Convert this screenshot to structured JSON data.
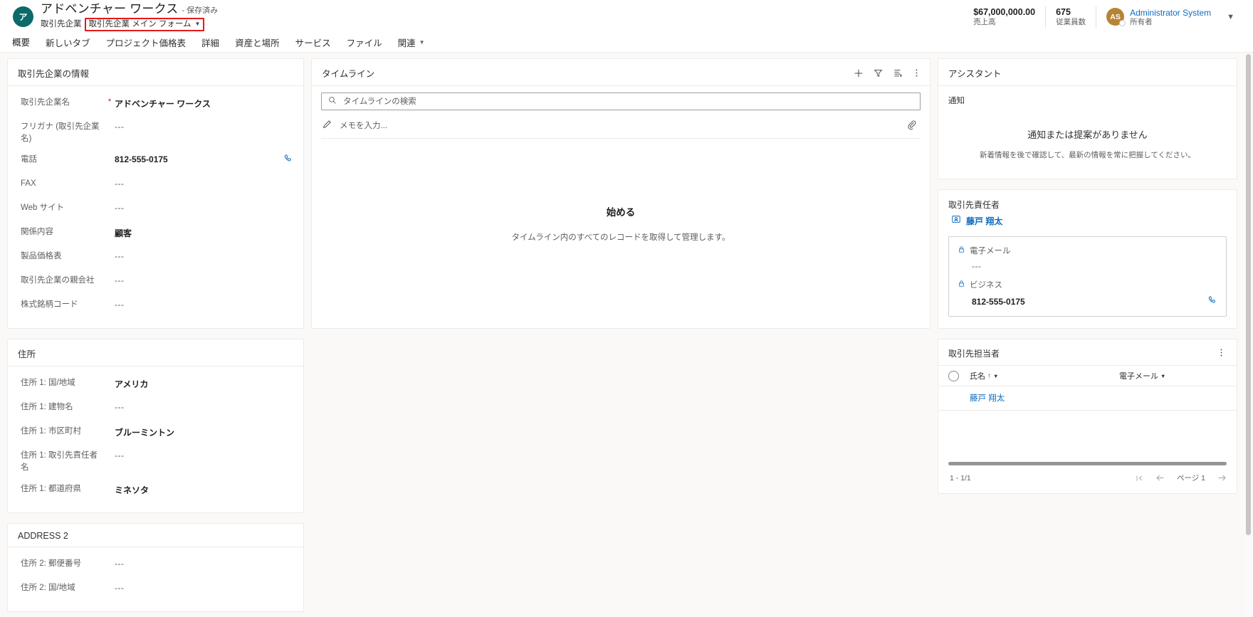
{
  "header": {
    "avatar_initial": "ア",
    "record_title": "アドベンチャー ワークス",
    "saved_state": "- 保存済み",
    "entity_name": "取引先企業",
    "form_selector": "取引先企業 メイン フォーム",
    "kpis": [
      {
        "value": "$67,000,000.00",
        "label": "売上高"
      },
      {
        "value": "675",
        "label": "従業員数"
      }
    ],
    "owner": {
      "initials": "AS",
      "name": "Administrator System",
      "role": "所有者"
    },
    "accent_highlight": "#e31a1c"
  },
  "tabs": [
    {
      "label": "概要",
      "has_chevron": false
    },
    {
      "label": "新しいタブ",
      "has_chevron": false
    },
    {
      "label": "プロジェクト価格表",
      "has_chevron": false
    },
    {
      "label": "詳細",
      "has_chevron": false
    },
    {
      "label": "資産と場所",
      "has_chevron": false
    },
    {
      "label": "サービス",
      "has_chevron": false
    },
    {
      "label": "ファイル",
      "has_chevron": false
    },
    {
      "label": "関連",
      "has_chevron": true
    }
  ],
  "account_info": {
    "title": "取引先企業の情報",
    "fields": [
      {
        "label": "取引先企業名",
        "value": "アドベンチャー ワークス",
        "required": true,
        "empty": false,
        "icon": ""
      },
      {
        "label": "フリガナ (取引先企業名)",
        "value": "---",
        "required": false,
        "empty": true,
        "icon": ""
      },
      {
        "label": "電話",
        "value": "812-555-0175",
        "required": false,
        "empty": false,
        "icon": "phone-icon"
      },
      {
        "label": "FAX",
        "value": "---",
        "required": false,
        "empty": true,
        "icon": ""
      },
      {
        "label": "Web サイト",
        "value": "---",
        "required": false,
        "empty": true,
        "icon": ""
      },
      {
        "label": "関係内容",
        "value": "顧客",
        "required": false,
        "empty": false,
        "icon": ""
      },
      {
        "label": "製品価格表",
        "value": "---",
        "required": false,
        "empty": true,
        "icon": ""
      },
      {
        "label": "取引先企業の親会社",
        "value": "---",
        "required": false,
        "empty": true,
        "icon": ""
      },
      {
        "label": "株式銘柄コード",
        "value": "---",
        "required": false,
        "empty": true,
        "icon": ""
      }
    ]
  },
  "address_1": {
    "title": "住所",
    "fields": [
      {
        "label": "住所 1: 国/地域",
        "value": "アメリカ",
        "empty": false
      },
      {
        "label": "住所 1: 建物名",
        "value": "---",
        "empty": true
      },
      {
        "label": "住所 1: 市区町村",
        "value": "ブルーミントン",
        "empty": false
      },
      {
        "label": "住所 1: 取引先責任者名",
        "value": "---",
        "empty": true
      },
      {
        "label": "住所 1: 都道府県",
        "value": "ミネソタ",
        "empty": false
      }
    ]
  },
  "address_2": {
    "title": "ADDRESS 2",
    "fields": [
      {
        "label": "住所 2: 郵便番号",
        "value": "---",
        "empty": true
      },
      {
        "label": "住所 2: 国/地域",
        "value": "---",
        "empty": true
      }
    ]
  },
  "timeline": {
    "title": "タイムライン",
    "actions": [
      "add-icon",
      "filter-icon",
      "sort-icon",
      "more-icon"
    ],
    "search_placeholder": "タイムラインの検索",
    "search_value": "",
    "note_placeholder": "メモを入力...",
    "note_value": "",
    "empty_title": "始める",
    "empty_subtitle": "タイムライン内のすべてのレコードを取得して管理します。"
  },
  "assistant": {
    "title": "アシスタント",
    "section_label": "通知",
    "empty_title": "通知または提案がありません",
    "empty_subtitle": "新着情報を後で確認して、最新の情報を常に把握してください。"
  },
  "primary_contact": {
    "title": "取引先責任者",
    "name": "藤戸 翔太",
    "fields": [
      {
        "label": "電子メール",
        "value": "---",
        "empty": true,
        "icon": "lock-icon",
        "trailing": ""
      },
      {
        "label": "ビジネス",
        "value": "812-555-0175",
        "empty": false,
        "icon": "lock-icon",
        "trailing": "phone-icon"
      }
    ]
  },
  "contacts_grid": {
    "title": "取引先担当者",
    "columns": [
      {
        "label": "氏名",
        "sorted": true,
        "sort_dir": "↑"
      },
      {
        "label": "電子メール",
        "sorted": false,
        "sort_dir": ""
      }
    ],
    "rows": [
      {
        "name": "藤戸 翔太",
        "email": ""
      }
    ],
    "record_count": "1 - 1/1",
    "page_label": "ページ",
    "page_number": "1"
  }
}
